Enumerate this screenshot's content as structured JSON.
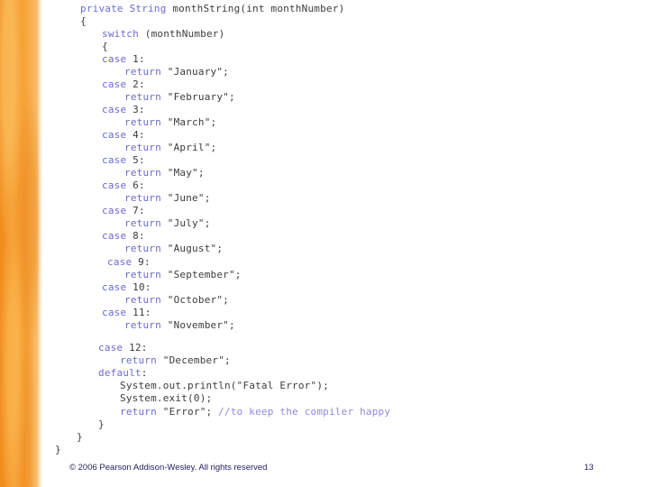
{
  "code": {
    "l1": {
      "kw": "private String",
      "text": " monthString(int monthNumber)"
    },
    "l2": {
      "text": "{"
    },
    "l3": {
      "kw": "switch",
      "text": " (monthNumber)"
    },
    "l4": {
      "text": "{"
    },
    "l5": {
      "kw": "case",
      "text": " 1:"
    },
    "l6": {
      "kw": "return",
      "text": " \"January\";"
    },
    "l7": {
      "kw": "case",
      "text": " 2:"
    },
    "l8": {
      "kw": "return",
      "text": " \"February\";"
    },
    "l9": {
      "kw": "case",
      "text": " 3:"
    },
    "l10": {
      "kw": "return",
      "text": " \"March\";"
    },
    "l11": {
      "kw": "case",
      "text": " 4:"
    },
    "l12": {
      "kw": "return",
      "text": " \"April\";"
    },
    "l13": {
      "kw": "case",
      "text": " 5:"
    },
    "l14": {
      "kw": "return",
      "text": " \"May\";"
    },
    "l15": {
      "kw": "case",
      "text": " 6:"
    },
    "l16": {
      "kw": "return",
      "text": " \"June\";"
    },
    "l17": {
      "kw": "case",
      "text": " 7:"
    },
    "l18": {
      "kw": "return",
      "text": " \"July\";"
    },
    "l19": {
      "kw": "case",
      "text": " 8:"
    },
    "l20": {
      "kw": "return",
      "text": " \"August\";"
    },
    "l21": {
      "kw": "case",
      "text": " 9:"
    },
    "l22": {
      "kw": "return",
      "text": " \"September\";"
    },
    "l23": {
      "kw": "case",
      "text": " 10:"
    },
    "l24": {
      "kw": "return",
      "text": " \"October\";"
    },
    "l25": {
      "kw": "case",
      "text": " 11:"
    },
    "l26": {
      "kw": "return",
      "text": " \"November\";"
    },
    "l27": {
      "kw": "case",
      "text": " 12:"
    },
    "l28": {
      "kw": "return",
      "text": " \"December\";"
    },
    "l29": {
      "kw": "default",
      "text": ":"
    },
    "l30": {
      "text": "System.out.println(\"Fatal Error\");"
    },
    "l31": {
      "text": "System.exit(0);"
    },
    "l32": {
      "kw": "return",
      "text": " \"Error\"; ",
      "comment": "//to keep the compiler happy"
    },
    "l33": {
      "text": "}"
    },
    "l34": {
      "text": "}"
    },
    "l35": {
      "text": "}"
    }
  },
  "footer": {
    "copyright": "© 2006 Pearson Addison-Wesley. All rights reserved",
    "page_number": "13"
  },
  "colors": {
    "keyword": "#6a6ad0",
    "comment": "#8a8ae0",
    "band": "#f08c1c"
  }
}
